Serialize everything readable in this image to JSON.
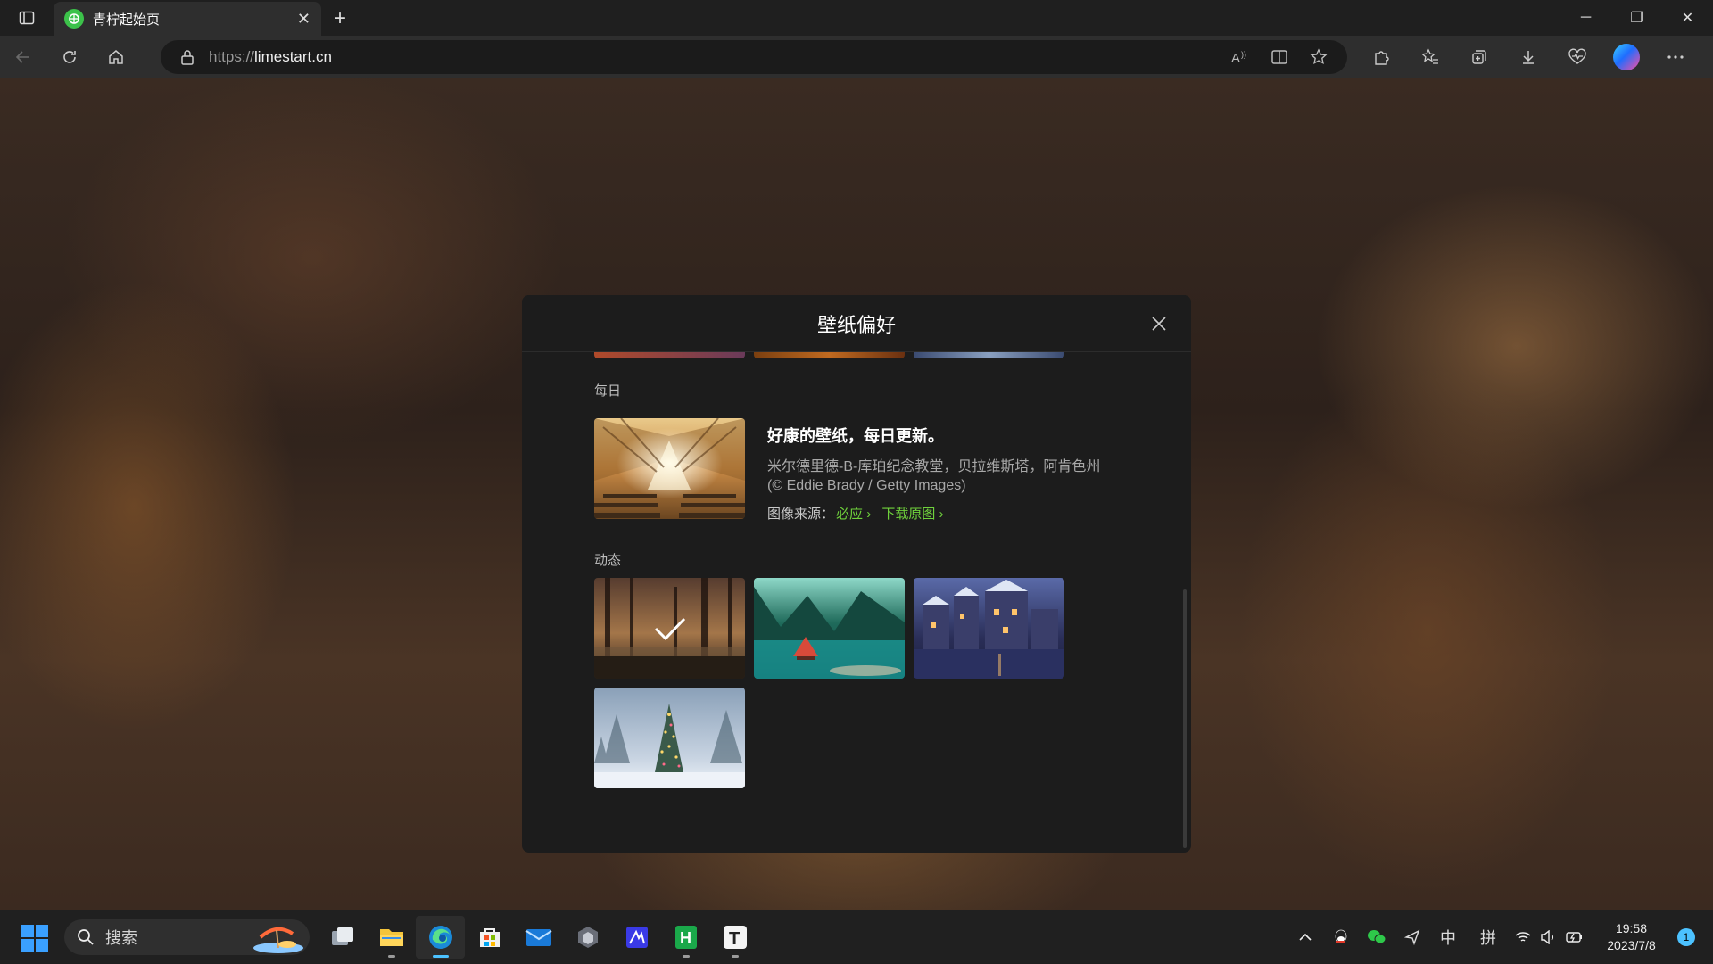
{
  "browser": {
    "tab_title": "青柠起始页",
    "url_scheme": "https://",
    "url_host": "limestart.cn"
  },
  "modal": {
    "title": "壁纸偏好",
    "daily": {
      "label": "每日",
      "headline": "好康的壁纸，每日更新。",
      "description_line1": "米尔德里德-B-库珀纪念教堂，贝拉维斯塔，阿肯色州",
      "description_line2": "(© Eddie Brady / Getty Images)",
      "source_prefix": "图像来源：",
      "source_link": "必应",
      "download_link": "下载原图"
    },
    "dynamic": {
      "label": "动态",
      "items": [
        {
          "name": "forest-autumn",
          "selected": true
        },
        {
          "name": "mountain-lake-cabin",
          "selected": false
        },
        {
          "name": "winter-canal-town",
          "selected": false
        },
        {
          "name": "snowy-christmas-tree",
          "selected": false
        }
      ]
    }
  },
  "taskbar": {
    "search_placeholder": "搜索",
    "tray_ime_lang": "中",
    "tray_ime_mode": "拼",
    "time": "19:58",
    "date": "2023/7/8",
    "notification_count": "1"
  },
  "colors": {
    "link_green": "#6fd23c",
    "accent_blue": "#4cc2ff"
  }
}
